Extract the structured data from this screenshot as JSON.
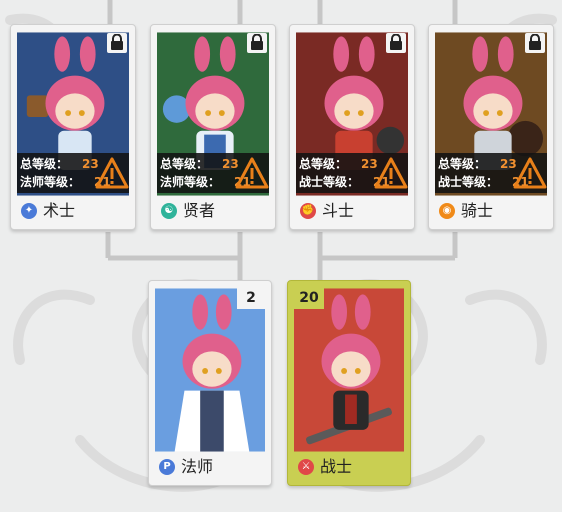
{
  "top_cards": [
    {
      "name": "术士",
      "level_label": "总等级：",
      "level_value": "23",
      "req_label": "法师等级：",
      "req_value": "21",
      "icon": "warlock-icon",
      "icon_color": "#4a7ad8",
      "bg_color": "#2e4f86",
      "locked": true
    },
    {
      "name": "贤者",
      "level_label": "总等级：",
      "level_value": "23",
      "req_label": "法师等级：",
      "req_value": "21",
      "icon": "sage-icon",
      "icon_color": "#2fb39a",
      "bg_color": "#2f6a3c",
      "locked": true
    },
    {
      "name": "斗士",
      "level_label": "总等级：",
      "level_value": "23",
      "req_label": "战士等级：",
      "req_value": "21",
      "icon": "fighter-icon",
      "icon_color": "#e04848",
      "bg_color": "#7a2a24",
      "locked": true
    },
    {
      "name": "骑士",
      "level_label": "总等级：",
      "level_value": "23",
      "req_label": "战士等级：",
      "req_value": "21",
      "icon": "knight-icon",
      "icon_color": "#f08a18",
      "bg_color": "#6e4a22",
      "locked": true
    }
  ],
  "bottom_cards": [
    {
      "name": "法师",
      "count": "2",
      "icon": "mage-icon",
      "icon_color": "#4a7ad8",
      "bg_color": "#6a9ee0"
    },
    {
      "name": "战士",
      "count": "20",
      "icon": "warrior-icon",
      "icon_color": "#e04848",
      "bg_color": "#c84838",
      "selected": true
    }
  ],
  "colors": {
    "accent_value": "#f09030",
    "selected": "#c9cf52",
    "panel": "#121212"
  }
}
